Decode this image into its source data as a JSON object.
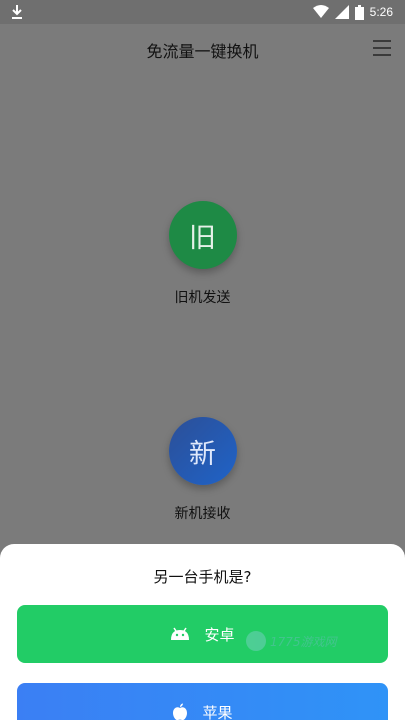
{
  "status_bar": {
    "time": "5:26",
    "icons": [
      "download-icon",
      "wifi-icon",
      "cellular-icon",
      "battery-icon"
    ]
  },
  "header": {
    "title": "免流量一键换机",
    "menu_icon": "menu-icon"
  },
  "old_phone": {
    "glyph": "旧",
    "label": "旧机发送",
    "color": "#1e8a45"
  },
  "new_phone": {
    "glyph": "新",
    "label": "新机接收",
    "color": "#1f63c8"
  },
  "sheet": {
    "title": "另一台手机是?",
    "android_label": "安卓",
    "apple_label": "苹果",
    "android_color": "#22cc66",
    "apple_color": "#3b7ff4"
  },
  "watermark": {
    "text": "1775游戏网"
  }
}
